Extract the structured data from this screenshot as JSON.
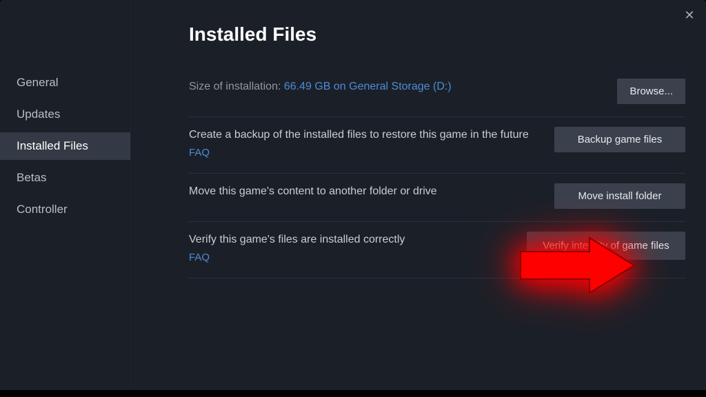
{
  "close_glyph": "✕",
  "sidebar": {
    "items": [
      {
        "label": "General"
      },
      {
        "label": "Updates"
      },
      {
        "label": "Installed Files"
      },
      {
        "label": "Betas"
      },
      {
        "label": "Controller"
      }
    ],
    "active_index": 2
  },
  "page": {
    "title": "Installed Files",
    "size_row": {
      "label": "Size of installation:",
      "value": "66.49 GB on General Storage (D:)",
      "button": "Browse..."
    },
    "backup_row": {
      "text": "Create a backup of the installed files to restore this game in the future",
      "faq": "FAQ",
      "button": "Backup game files"
    },
    "move_row": {
      "text": "Move this game's content to another folder or drive",
      "button": "Move install folder"
    },
    "verify_row": {
      "text": "Verify this game's files are installed correctly",
      "faq": "FAQ",
      "button": "Verify integrity of game files"
    }
  },
  "colors": {
    "accent_link": "#4e8bd6",
    "panel_bg": "#1b2028",
    "btn_bg": "#3a414d",
    "arrow": "#ff0000"
  }
}
